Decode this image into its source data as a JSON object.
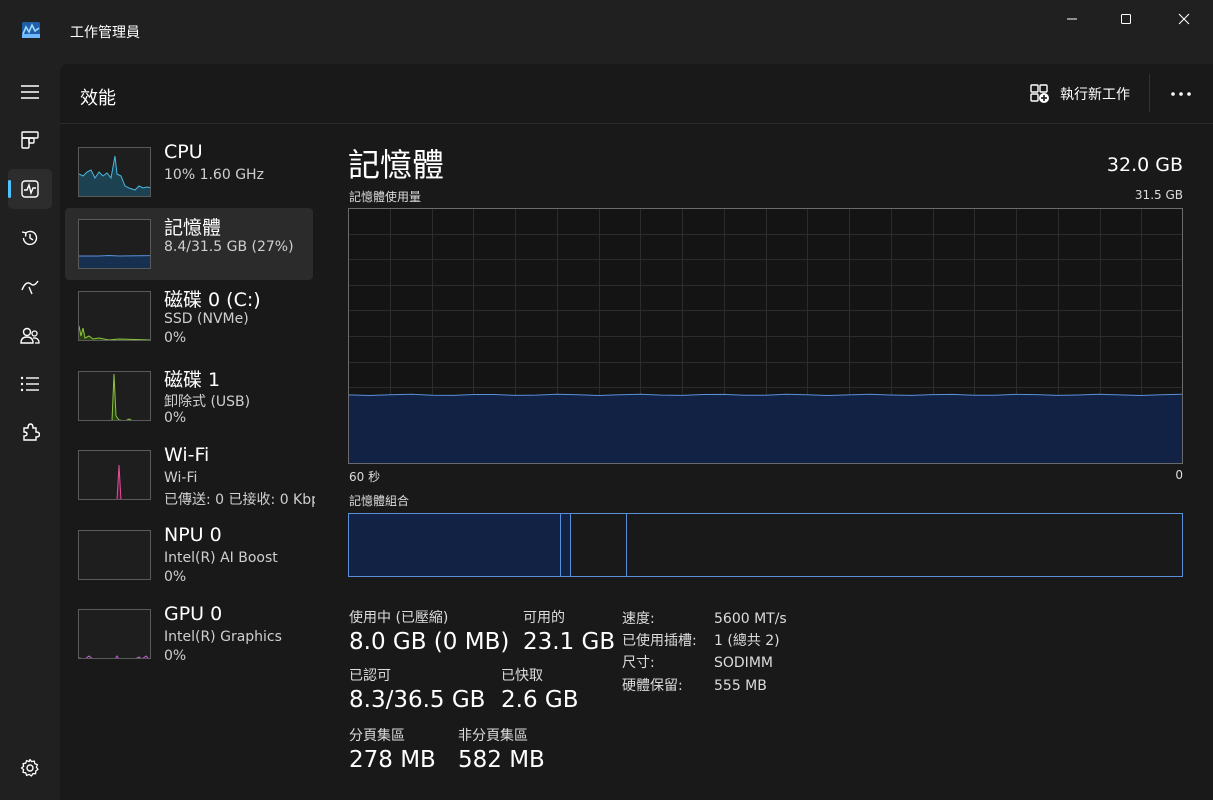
{
  "app": {
    "title": "工作管理員"
  },
  "header": {
    "title": "效能",
    "run_task_label": "執行新工作"
  },
  "devices": [
    {
      "name": "CPU",
      "sub1": "10%  1.60 GHz",
      "sub2": "",
      "color": "#4ab8de"
    },
    {
      "name": "記憶體",
      "sub1": "8.4/31.5 GB (27%)",
      "sub2": "",
      "color": "#5b8fd8"
    },
    {
      "name": "磁碟 0 (C:)",
      "sub1": "SSD (NVMe)",
      "sub2": "0%",
      "color": "#8cc63f"
    },
    {
      "name": "磁碟 1",
      "sub1": "卸除式 (USB)",
      "sub2": "0%",
      "color": "#8cc63f"
    },
    {
      "name": "Wi-Fi",
      "sub1": "Wi-Fi",
      "sub2": "已傳送: 0  已接收: 0 Kbps",
      "color": "#e84d9a"
    },
    {
      "name": "NPU 0",
      "sub1": "Intel(R) AI Boost",
      "sub2": "0%",
      "color": "#c060d0"
    },
    {
      "name": "GPU 0",
      "sub1": "Intel(R) Graphics",
      "sub2": "0%",
      "color": "#c060d0"
    }
  ],
  "detail": {
    "title": "記憶體",
    "total": "32.0 GB",
    "usage_label": "記憶體使用量",
    "usage_max": "31.5 GB",
    "axis_left": "60 秒",
    "axis_right": "0",
    "composition_label": "記憶體組合",
    "usage_fraction": 0.27
  },
  "composition": {
    "in_use_fraction": 0.254,
    "modified_fraction": 0.012,
    "standby_fraction": 0.068
  },
  "stats": {
    "in_use": {
      "label": "使用中 (已壓縮)",
      "value": "8.0 GB (0 MB)"
    },
    "available": {
      "label": "可用的",
      "value": "23.1 GB"
    },
    "committed": {
      "label": "已認可",
      "value": "8.3/36.5 GB"
    },
    "cached": {
      "label": "已快取",
      "value": "2.6 GB"
    },
    "paged_pool": {
      "label": "分頁集區",
      "value": "278 MB"
    },
    "non_paged_pool": {
      "label": "非分頁集區",
      "value": "582 MB"
    }
  },
  "specs": [
    {
      "key": "速度:",
      "value": "5600 MT/s"
    },
    {
      "key": "已使用插槽:",
      "value": "1 (總共 2)"
    },
    {
      "key": "尺寸:",
      "value": "SODIMM"
    },
    {
      "key": "硬體保留:",
      "value": "555 MB"
    }
  ],
  "colors": {
    "accent": "#4cc2ff",
    "memory": "#5b8fd8",
    "memory_fill": "#112244"
  }
}
